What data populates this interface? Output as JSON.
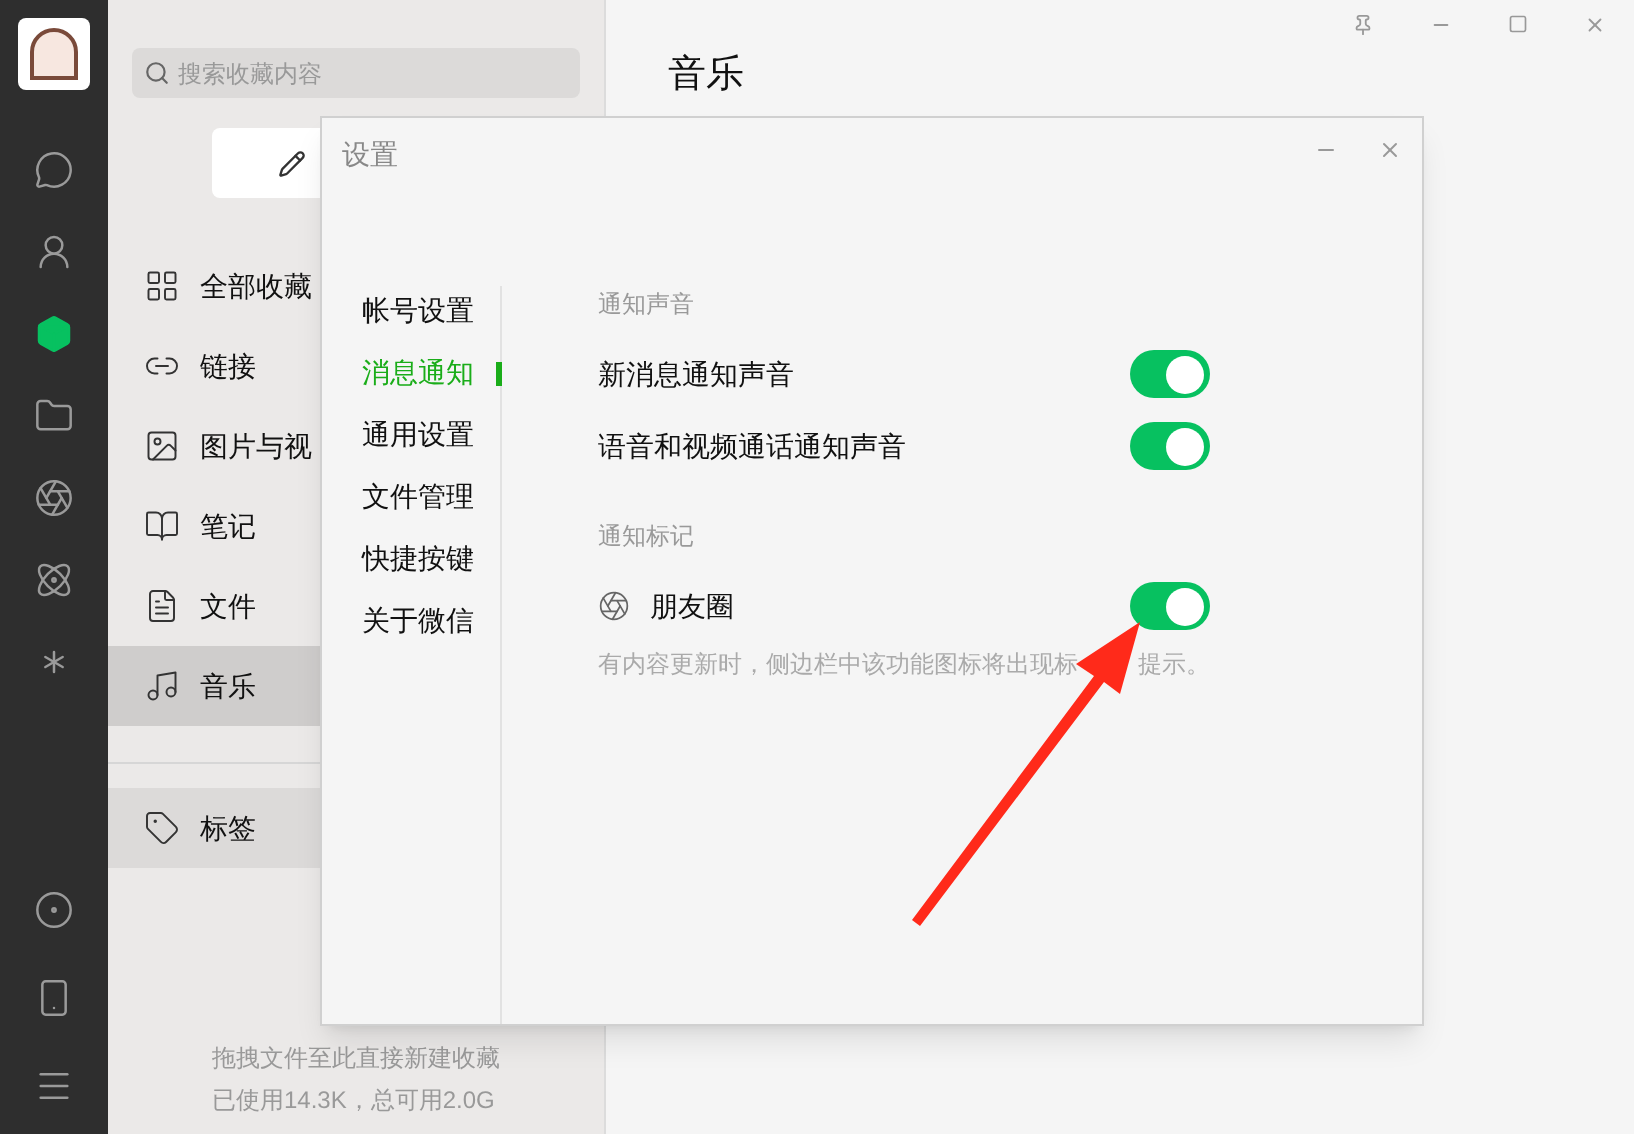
{
  "nav_bar": {
    "items": [
      {
        "kind": "chat",
        "selected": false
      },
      {
        "kind": "contacts",
        "selected": false
      },
      {
        "kind": "favorites",
        "selected": true
      },
      {
        "kind": "files",
        "selected": false
      },
      {
        "kind": "moments",
        "selected": false
      },
      {
        "kind": "atom",
        "selected": false
      },
      {
        "kind": "sparkle",
        "selected": false
      }
    ],
    "bottom_items": [
      {
        "kind": "miniprogram"
      },
      {
        "kind": "phone"
      },
      {
        "kind": "menu"
      }
    ]
  },
  "favorites_panel": {
    "search": {
      "placeholder": "搜索收藏内容"
    },
    "items": [
      {
        "kind": "grid",
        "label": "全部收藏",
        "selected": false
      },
      {
        "kind": "link",
        "label": "链接",
        "selected": false
      },
      {
        "kind": "image",
        "label": "图片与视",
        "selected": false
      },
      {
        "kind": "note",
        "label": "笔记",
        "selected": false
      },
      {
        "kind": "file",
        "label": "文件",
        "selected": false
      },
      {
        "kind": "music",
        "label": "音乐",
        "selected": true
      }
    ],
    "tags": {
      "label": "标签"
    },
    "footer": [
      "拖拽文件至此直接新建收藏",
      "已使用14.3K，总可用2.0G"
    ]
  },
  "content": {
    "title": "音乐"
  },
  "settings_dialog": {
    "title": "设置",
    "tabs": [
      {
        "label": "帐号设置",
        "selected": false
      },
      {
        "label": "消息通知",
        "selected": true
      },
      {
        "label": "通用设置",
        "selected": false
      },
      {
        "label": "文件管理",
        "selected": false
      },
      {
        "label": "快捷按键",
        "selected": false
      },
      {
        "label": "关于微信",
        "selected": false
      }
    ],
    "sections": [
      {
        "heading": "通知声音",
        "options": [
          {
            "label": "新消息通知声音",
            "on": true
          },
          {
            "label": "语音和视频通话通知声音",
            "on": true
          }
        ]
      },
      {
        "heading": "通知标记",
        "options": [
          {
            "label": "朋友圈",
            "on": true,
            "icon": true,
            "hint": [
              "有内容更新时，侧边栏中该功能图标将出现标",
              "提示。"
            ]
          }
        ]
      }
    ]
  }
}
